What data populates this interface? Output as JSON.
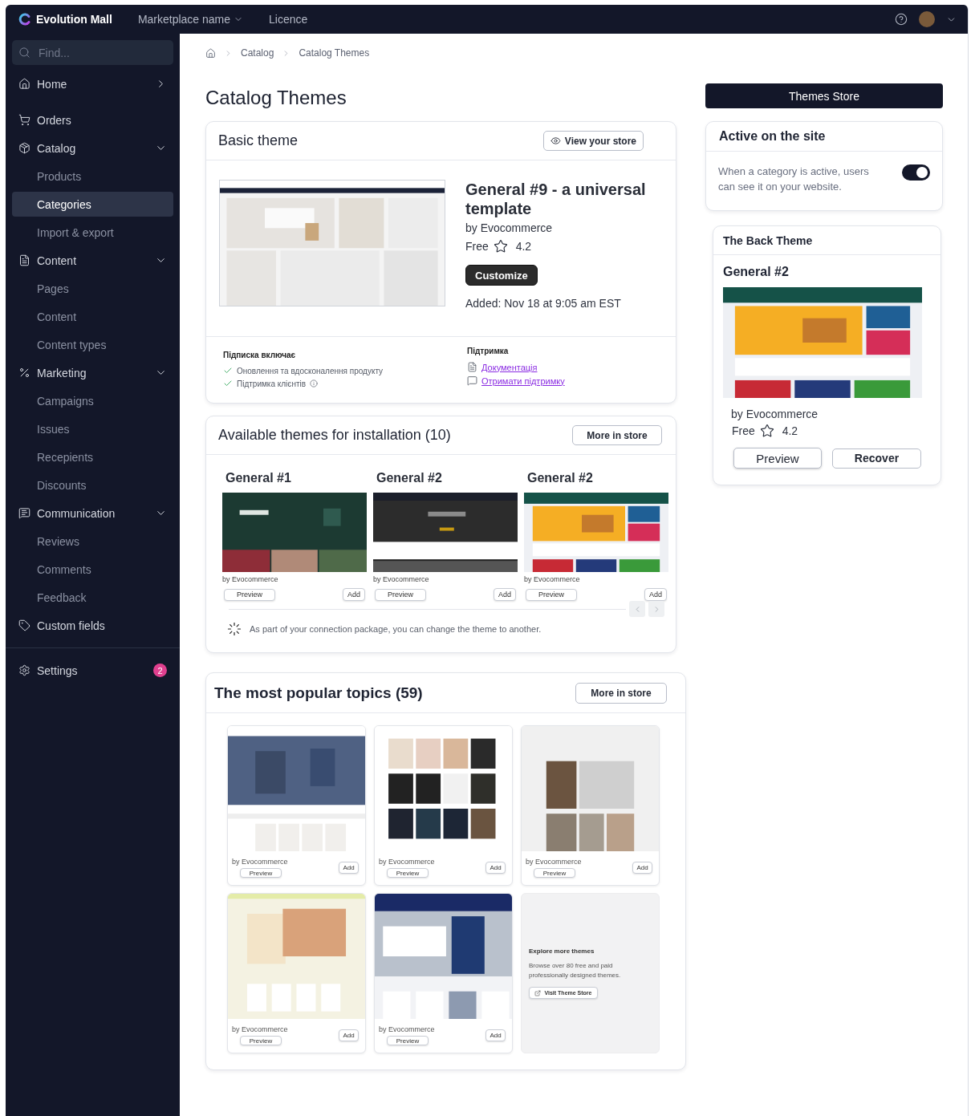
{
  "topbar": {
    "brand": "Evolution Mall",
    "menu": [
      {
        "label": "Marketplace name",
        "kind": "dropdown"
      },
      {
        "label": "Licence",
        "kind": "link"
      }
    ]
  },
  "sidebar": {
    "search": {
      "placeholder": "Find..."
    },
    "items": [
      {
        "label": "Home",
        "kind": "link"
      },
      {
        "label": "Orders",
        "kind": "plain"
      },
      {
        "label": "Catalog",
        "kind": "group",
        "expanded": true,
        "children": [
          {
            "label": "Products",
            "selected": false
          },
          {
            "label": "Categories",
            "selected": true
          },
          {
            "label": "Import & export",
            "selected": false
          }
        ]
      },
      {
        "label": "Content",
        "kind": "group",
        "expanded": true,
        "children": [
          {
            "label": "Pages",
            "selected": false
          },
          {
            "label": "Content",
            "selected": false
          },
          {
            "label": "Content types",
            "selected": false
          }
        ]
      },
      {
        "label": "Marketing",
        "kind": "group",
        "expanded": true,
        "children": [
          {
            "label": "Campaigns",
            "selected": false
          },
          {
            "label": "Issues",
            "selected": false
          },
          {
            "label": "Recepients",
            "selected": false
          },
          {
            "label": "Discounts",
            "selected": false
          }
        ]
      },
      {
        "label": "Communication",
        "kind": "group",
        "expanded": true,
        "children": [
          {
            "label": "Reviews",
            "selected": false
          },
          {
            "label": "Comments",
            "selected": false
          },
          {
            "label": "Feedback",
            "selected": false
          }
        ]
      },
      {
        "label": "Custom fields",
        "kind": "plain"
      }
    ],
    "bottom_items": [
      {
        "label": "Settings",
        "badge": "2"
      }
    ]
  },
  "breadcrumb": [
    "Catalog",
    "Catalog Themes"
  ],
  "page_title": "Catalog Themes",
  "basic_theme": {
    "title": "Basic theme",
    "view_button": "View your store",
    "theme": {
      "name": "General #9 - a universal template",
      "author": "by Evocommerce",
      "price": "Free",
      "rating": "4.2",
      "action": "Customize",
      "added": "Added: Nov 18 at 9:05 am EST"
    },
    "includes": {
      "title": "Підписка включає",
      "items": [
        {
          "label": "Оновлення та вдосконалення продукту",
          "info": false
        },
        {
          "label": "Підтримка клієнтів",
          "info": true
        }
      ]
    },
    "support": {
      "title": "Підтримка",
      "links": [
        {
          "label": "Документація",
          "kind": "docs"
        },
        {
          "label": "Отримати підтримку",
          "kind": "chat"
        }
      ]
    }
  },
  "available": {
    "title": "Available themes for installation (10)",
    "more": "More in store",
    "themes": [
      {
        "name": "General #1",
        "author": "by Evocommerce",
        "preview": "Preview",
        "add": "Add"
      },
      {
        "name": "General #2",
        "author": "by Evocommerce",
        "preview": "Preview",
        "add": "Add"
      },
      {
        "name": "General #2",
        "author": "by Evocommerce",
        "preview": "Preview",
        "add": "Add"
      }
    ],
    "note": "As part of your connection package, you can change the theme to another."
  },
  "popular": {
    "title": "The most popular topics (59)",
    "more": "More in store",
    "themes": [
      {
        "author": "by Evocommerce",
        "preview": "Preview",
        "add": "Add"
      },
      {
        "author": "by Evocommerce",
        "preview": "Preview",
        "add": "Add"
      },
      {
        "author": "by Evocommerce",
        "preview": "Preview",
        "add": "Add"
      },
      {
        "author": "by Evocommerce",
        "preview": "Preview",
        "add": "Add"
      },
      {
        "author": "by Evocommerce",
        "preview": "Preview",
        "add": "Add"
      }
    ],
    "explore": {
      "title": "Explore more themes",
      "text": "Browse over 80 free and paid professionally designed themes.",
      "link": "Visit Theme Store"
    }
  },
  "right": {
    "store_button": "Themes Store",
    "active": {
      "title": "Active on the site",
      "text": "When a category is active, users can see it on your website.",
      "on": true
    },
    "back_theme": {
      "title": "The Back Theme",
      "name": "General #2",
      "author": "by Evocommerce",
      "price": "Free",
      "rating": "4.2",
      "preview": "Preview",
      "recover": "Recover"
    }
  }
}
